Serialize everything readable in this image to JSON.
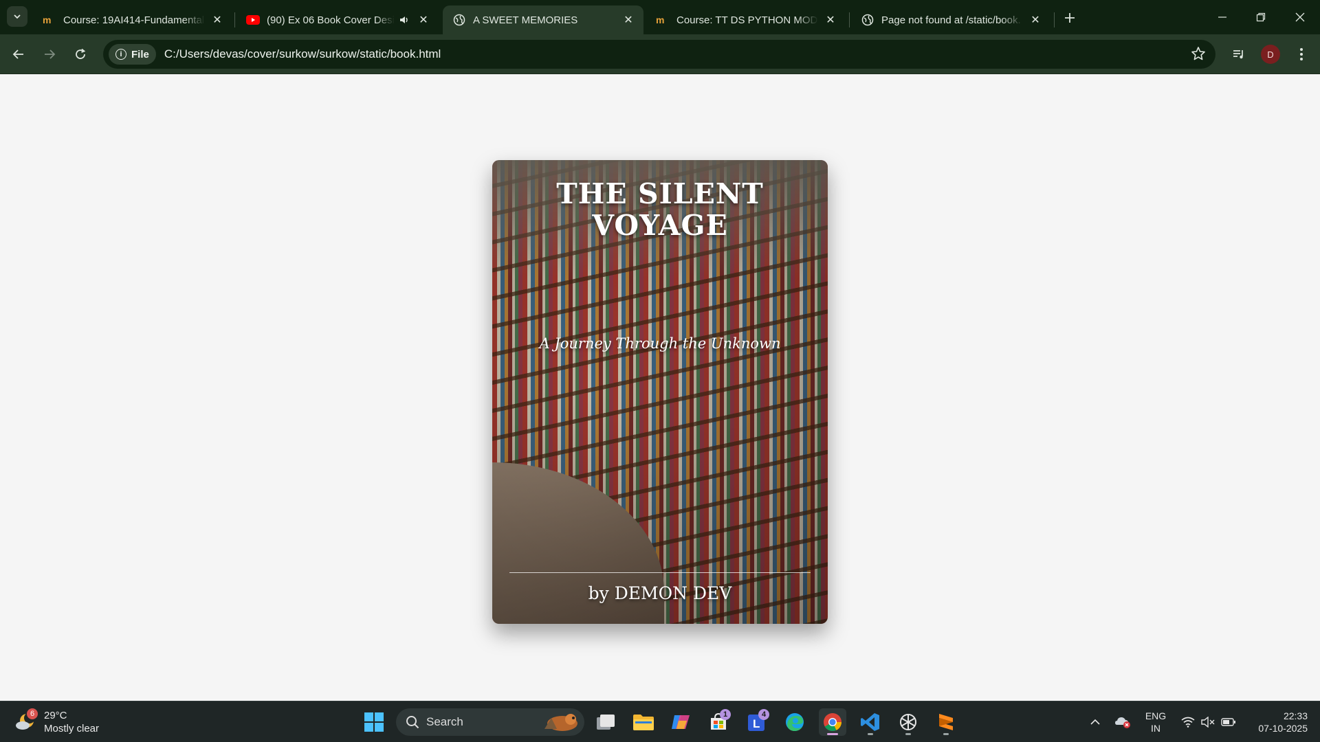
{
  "browser": {
    "tabs": [
      {
        "title": "Course: 19AI414-Fundamentals",
        "favicon": "course-icon"
      },
      {
        "title": "(90) Ex 06 Book Cover Desig",
        "favicon": "youtube-icon",
        "audio": true
      },
      {
        "title": "A SWEET MEMORIES",
        "favicon": "globe-icon",
        "active": true
      },
      {
        "title": "Course: TT DS PYTHON MODUL",
        "favicon": "course-icon"
      },
      {
        "title": "Page not found at /static/book.",
        "favicon": "globe-icon"
      }
    ],
    "chip_label": "File",
    "url": "C:/Users/devas/cover/surkow/surkow/static/book.html",
    "profile_initial": "D"
  },
  "book": {
    "title_line1": "THE SILENT",
    "title_line2": "VOYAGE",
    "subtitle": "A Journey Through the Unknown",
    "author": "by DEMON DEV"
  },
  "taskbar": {
    "weather_badge": "6",
    "temperature": "29°C",
    "condition": "Mostly clear",
    "search_label": "Search",
    "store_badge": "1",
    "teams_badge": "4",
    "lang_line1": "ENG",
    "lang_line2": "IN",
    "time": "22:33",
    "date": "07-10-2025"
  },
  "colors": {
    "chrome_dark": "#0f2211",
    "chrome_toolbar": "#273b29",
    "page_bg": "#f5f5f5",
    "taskbar_bg": "#1f2626"
  }
}
